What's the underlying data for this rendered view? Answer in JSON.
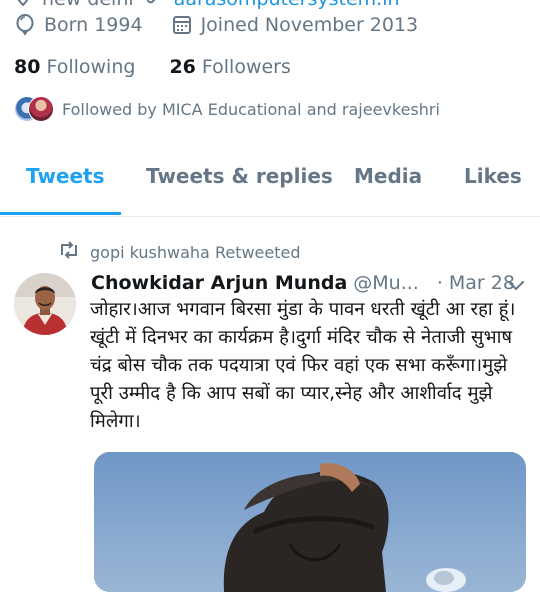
{
  "profile": {
    "location": "new delhi",
    "website": "aarasomputersystem.in",
    "born": "Born 1994",
    "joined": "Joined November 2013",
    "following_count": "80",
    "following_label": "Following",
    "followers_count": "26",
    "followers_label": "Followers",
    "followed_by": "Followed by MICA Educational and rajeevkeshri"
  },
  "tabs": [
    {
      "label": "Tweets",
      "active": true
    },
    {
      "label": "Tweets & replies",
      "active": false
    },
    {
      "label": "Media",
      "active": false
    },
    {
      "label": "Likes",
      "active": false
    }
  ],
  "tweet": {
    "retweeted_by": "gopi kushwaha Retweeted",
    "author_name": "Chowkidar Arjun Munda",
    "handle": "@Mu...",
    "separator": "·",
    "date": "Mar 28",
    "text": "जोहार।आज भगवान बिरसा मुंडा के पावन धरती खूंटी आ रहा हूं।खूंटी में दिनभर का कार्यक्रम है।दुर्गा मंदिर चौक से नेताजी सुभाष चंद्र बोस चौक तक पदयात्रा एवं फिर वहां एक सभा करूँगा।मुझे पूरी उम्मीद है कि आप सबों का प्यार,स्नेह और आशीर्वाद मुझे मिलेगा।"
  },
  "colors": {
    "accent": "#1da1f2",
    "link": "#1b95e0",
    "muted": "#657786",
    "text": "#14171a",
    "divider": "#e6ecf0"
  }
}
